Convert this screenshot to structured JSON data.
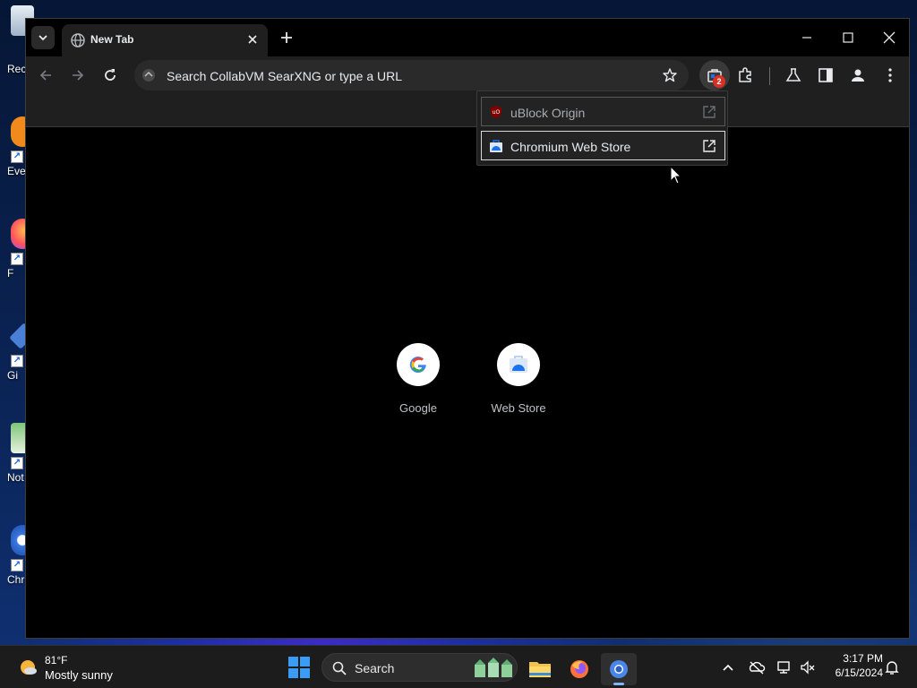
{
  "desktop": {
    "icons": [
      {
        "label": "Rec"
      },
      {
        "label": "Eve"
      },
      {
        "label": "F"
      },
      {
        "label": "Gi"
      },
      {
        "label": "Not"
      },
      {
        "label": "Chr"
      }
    ]
  },
  "browser": {
    "tab": {
      "title": "New Tab"
    },
    "omnibox": {
      "placeholder": "Search CollabVM SearXNG or type a URL"
    },
    "extensions_badge": "2",
    "popup": {
      "items": [
        {
          "name": "uBlock Origin"
        },
        {
          "name": "Chromium Web Store"
        }
      ]
    },
    "shortcuts": [
      {
        "label": "Google"
      },
      {
        "label": "Web Store"
      }
    ]
  },
  "taskbar": {
    "weather": {
      "temp": "81°F",
      "condition": "Mostly sunny"
    },
    "search": {
      "label": "Search"
    },
    "clock": {
      "time": "3:17 PM",
      "date": "6/15/2024"
    }
  },
  "colors": {
    "accent": "#7fb5ff",
    "badge": "#d93025",
    "ublock_red": "#800000",
    "webstore_blue": "#1a73e8"
  },
  "icons": [
    "tab-search-icon",
    "globe-icon",
    "close-icon",
    "plus-icon",
    "minimize-icon",
    "maximize-icon",
    "back-icon",
    "forward-icon",
    "reload-icon",
    "star-icon",
    "extensions-store-icon",
    "puzzle-icon",
    "labs-icon",
    "side-panel-icon",
    "profile-icon",
    "menu-icon",
    "open-external-icon"
  ]
}
